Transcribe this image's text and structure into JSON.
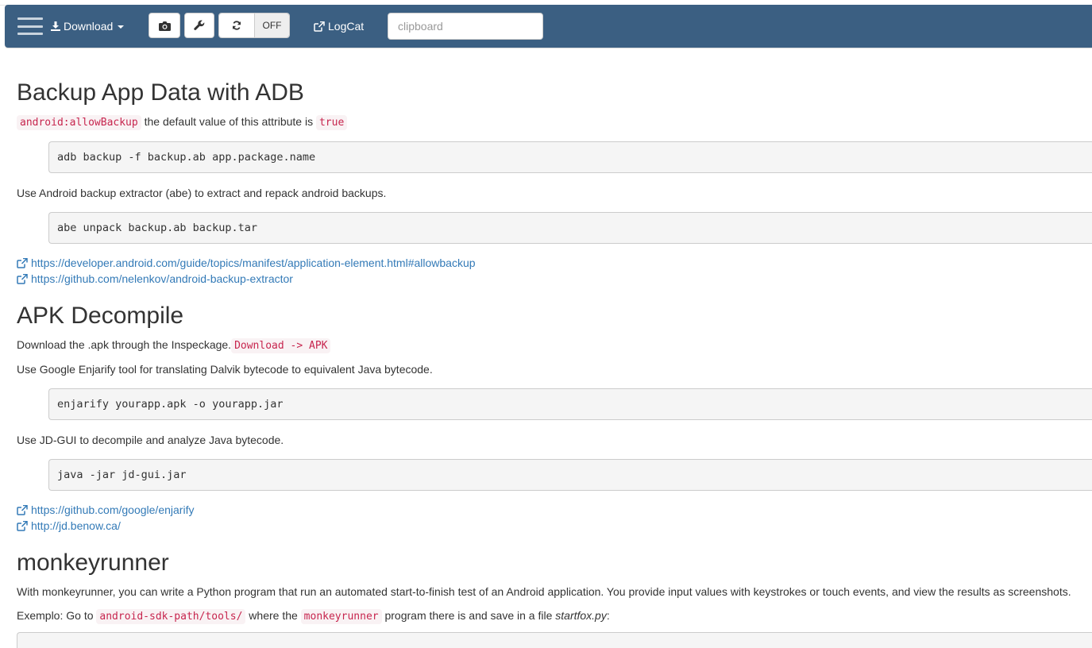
{
  "toolbar": {
    "download_label": "Download",
    "toggle_state": "OFF",
    "logcat_label": "LogCat",
    "clipboard_placeholder": "clipboard",
    "clipboard_value": ""
  },
  "sections": {
    "backup": {
      "title": "Backup App Data with ADB",
      "attr_code": "android:allowBackup",
      "attr_text": "the default value of this attribute is",
      "attr_value": "true",
      "cmd1": "adb backup -f backup.ab app.package.name",
      "abe_text": "Use Android backup extractor (abe) to extract and repack android backups.",
      "cmd2": "abe unpack backup.ab backup.tar",
      "links": [
        "https://developer.android.com/guide/topics/manifest/application-element.html#allowbackup",
        "https://github.com/nelenkov/android-backup-extractor"
      ]
    },
    "apk": {
      "title": "APK Decompile",
      "download_text": "Download the .apk through the Inspeckage.",
      "download_code": "Download -> APK",
      "enjarify_text": "Use Google Enjarify tool for translating Dalvik bytecode to equivalent Java bytecode.",
      "cmd1": "enjarify yourapp.apk -o yourapp.jar",
      "jdgui_text": "Use JD-GUI to decompile and analyze Java bytecode.",
      "cmd2": "java -jar jd-gui.jar",
      "links": [
        "https://github.com/google/enjarify",
        "http://jd.benow.ca/"
      ]
    },
    "monkey": {
      "title": "monkeyrunner",
      "intro": "With monkeyrunner, you can write a Python program that run an automated start-to-finish test of an Android application. You provide input values with keystrokes or touch events, and view the results as screenshots.",
      "ex_prefix": "Exemplo: Go to",
      "ex_code1": "android-sdk-path/tools/",
      "ex_mid": "where the",
      "ex_code2": "monkeyrunner",
      "ex_suffix": "program there is and save in a file",
      "ex_file": "startfox.py",
      "ex_colon": ":"
    }
  },
  "colors": {
    "navbar": "#3b5f82",
    "link": "#337ab7",
    "code_text": "#c7254e",
    "code_bg": "#f9f2f4",
    "pre_bg": "#f5f5f5"
  },
  "icons": [
    "menu-icon",
    "download-icon",
    "caret-down-icon",
    "camera-icon",
    "wrench-icon",
    "refresh-icon",
    "external-link-icon"
  ]
}
